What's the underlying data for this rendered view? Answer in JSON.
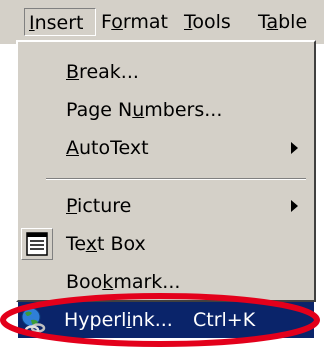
{
  "menubar": {
    "items": [
      {
        "prefix": "",
        "mnemonic": "I",
        "rest": "nsert"
      },
      {
        "prefix": "F",
        "mnemonic": "o",
        "rest": "rmat"
      },
      {
        "prefix": "",
        "mnemonic": "T",
        "rest": "ools"
      },
      {
        "prefix": "T",
        "mnemonic": "a",
        "rest": "ble"
      }
    ]
  },
  "insert_menu": {
    "items": [
      {
        "prefix": "",
        "mnemonic": "B",
        "rest": "reak..."
      },
      {
        "prefix": "Page N",
        "mnemonic": "u",
        "rest": "mbers..."
      },
      {
        "prefix": "",
        "mnemonic": "A",
        "rest": "utoText"
      },
      {
        "prefix": "",
        "mnemonic": "P",
        "rest": "icture"
      },
      {
        "prefix": "Te",
        "mnemonic": "x",
        "rest": "t Box"
      },
      {
        "prefix": "Boo",
        "mnemonic": "k",
        "rest": "mark..."
      },
      {
        "prefix": "Hyperl",
        "mnemonic": "i",
        "rest": "nk...",
        "shortcut": "Ctrl+K"
      }
    ]
  },
  "colors": {
    "menu_face": "#d4d0c8",
    "highlight": "#0a246a",
    "annotation_ellipse": "#e3001b"
  },
  "icons": [
    "submenu-arrow-icon",
    "text-box-icon",
    "hyperlink-globe-icon"
  ]
}
